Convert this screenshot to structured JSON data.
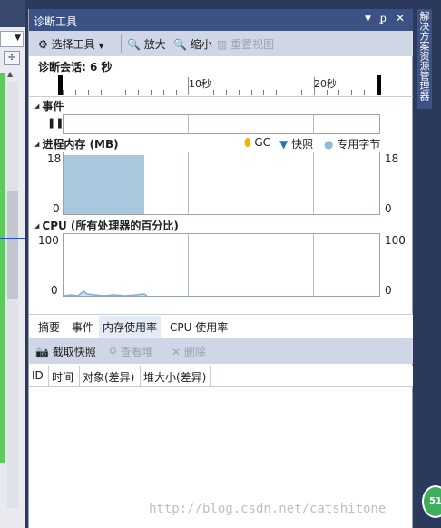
{
  "window": {
    "title": "诊断工具",
    "title_icons": [
      "dropdown-icon",
      "pin-icon",
      "close-icon"
    ]
  },
  "toolbar": {
    "select_tool_label": "选择工具",
    "zoom_in_label": "放大",
    "zoom_out_label": "缩小",
    "reset_view_label": "重置视图"
  },
  "session": {
    "label": "诊断会话: 6 秒"
  },
  "ruler": {
    "labels": [
      "10秒",
      "20秒"
    ]
  },
  "events": {
    "title": "事件"
  },
  "memory": {
    "title": "进程内存 (MB)",
    "y_top": "18",
    "y_bottom": "0",
    "legend": [
      {
        "label": "GC",
        "marker": "flag",
        "color": "#f5b400"
      },
      {
        "label": "快照",
        "marker": "triangle-down",
        "color": "#1e72c4"
      },
      {
        "label": "专用字节",
        "marker": "circle",
        "color": "#8fbad8"
      }
    ],
    "fill_color": "#a8c8de",
    "fill_level": 0.95
  },
  "cpu": {
    "title": "CPU (所有处理器的百分比)",
    "y_top": "100",
    "y_bottom": "0",
    "line_color": "#7fb0d4"
  },
  "tabs": [
    "摘要",
    "事件",
    "内存使用率",
    "CPU 使用率"
  ],
  "active_tab": "内存使用率",
  "memory_toolbar": {
    "snapshot_label": "截取快照",
    "view_heap_label": "查看堆",
    "delete_label": "删除"
  },
  "table": {
    "columns": [
      "ID",
      "时间",
      "对象(差异)",
      "堆大小(差异)"
    ]
  },
  "right_dock": {
    "tab_label": "解决方案资源管理器",
    "badge": "51"
  },
  "watermark": "http://blog.csdn.net/catshitone",
  "colors": {
    "title_bar": "#3d5284",
    "toolbar": "#cfd6e5",
    "ide_frame": "#2b3a5c"
  }
}
